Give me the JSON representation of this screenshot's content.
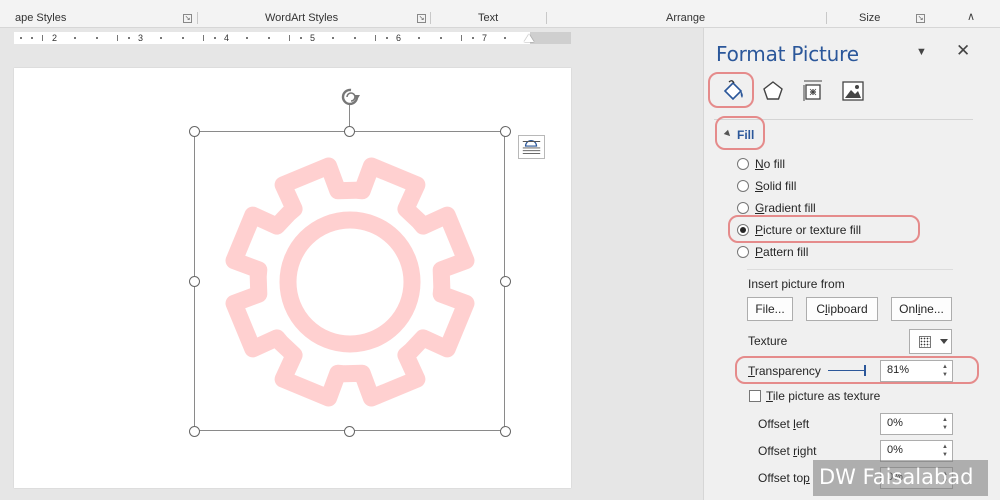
{
  "ribbon": {
    "groups": [
      {
        "label": "ape Styles"
      },
      {
        "label": "WordArt Styles"
      },
      {
        "label": "Text"
      },
      {
        "label": "Arrange"
      },
      {
        "label": "Size"
      }
    ]
  },
  "ruler": {
    "numbers": [
      "2",
      "3",
      "4",
      "5",
      "6",
      "7"
    ]
  },
  "pane": {
    "title": "Format Picture",
    "menu_icon": "dropdown-caret-icon",
    "close_icon": "close-icon",
    "tabs": [
      {
        "name": "fill-line",
        "icon": "paint-bucket-icon",
        "active": true
      },
      {
        "name": "effects",
        "icon": "pentagon-icon"
      },
      {
        "name": "size-properties",
        "icon": "size-properties-icon"
      },
      {
        "name": "picture",
        "icon": "picture-icon"
      }
    ],
    "fill": {
      "section_label": "Fill",
      "options": [
        {
          "key": "N",
          "rest": "o fill",
          "selected": false
        },
        {
          "key": "S",
          "rest": "olid fill",
          "selected": false
        },
        {
          "key": "G",
          "rest": "radient fill",
          "selected": false
        },
        {
          "key": "P",
          "rest": "icture or texture fill",
          "selected": true
        },
        {
          "key": "P",
          "rest": "attern fill",
          "selected": false
        }
      ],
      "insert_picture_from": "Insert picture from",
      "file_btn": "File...",
      "clipboard_btn": {
        "pre": "C",
        "key": "l",
        "rest": "ipboard"
      },
      "online_btn": {
        "pre": "Onl",
        "key": "i",
        "rest": "ne..."
      },
      "texture_label": "Texture",
      "transparency_label": {
        "key": "T",
        "rest": "ransparency"
      },
      "transparency_value": "81%",
      "transparency_fraction": 0.81,
      "tile_label": {
        "key": "T",
        "rest": "ile picture as texture"
      },
      "tile_checked": false,
      "offset_left": {
        "pre": "Offset ",
        "key": "l",
        "rest": "eft",
        "value": "0%"
      },
      "offset_right": {
        "pre": "Offset ",
        "key": "r",
        "rest": "ight",
        "value": "0%"
      },
      "offset_top": {
        "pre": "Offset to",
        "key": "p",
        "rest": "",
        "value": "0%"
      }
    }
  },
  "canvas": {
    "image_icon": "gear-icon",
    "gear_color": "#ffd0d0",
    "highlight_color": "#e58b8b",
    "accent": "#2b579a"
  },
  "watermark": "DW Faisalabad"
}
